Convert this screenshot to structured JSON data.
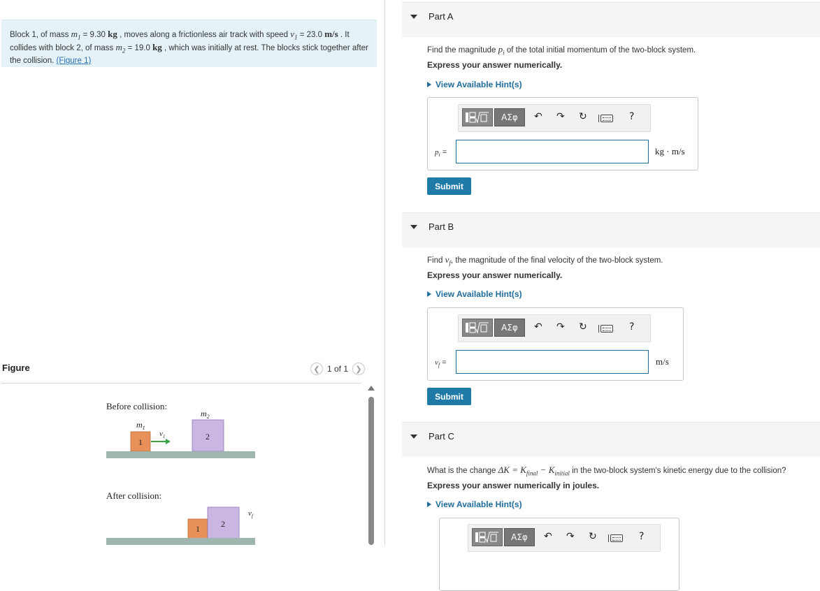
{
  "problem": {
    "t1": "Block 1, of mass ",
    "m1_sym": "m",
    "m1_sub": "1",
    "t2": " = 9.30 ",
    "kg1": "kg",
    "t3": " , moves along a frictionless air track with speed ",
    "v1_sym": "v",
    "v1_sub": "1",
    "t4": " = 23.0 ",
    "mps": "m/s",
    "t5": " . It collides with block 2, of mass ",
    "m2_sym": "m",
    "m2_sub": "2",
    "t6": " = 19.0 ",
    "kg2": "kg",
    "t7": " , which was initially at rest. The blocks stick together after the collision. ",
    "figure_link": "(Figure 1)"
  },
  "figure_panel": {
    "label": "Figure",
    "page": "1 of 1",
    "prev_icon": "chevron-left-icon",
    "next_icon": "chevron-right-icon",
    "before_label": "Before collision:",
    "after_label": "After collision:",
    "m1_label": "m",
    "m1_sub": "1",
    "m2_label": "m",
    "m2_sub": "2",
    "v1_label": "v",
    "v1_sub": "1",
    "vf_label": "v",
    "vf_sub": "f",
    "block1": "1",
    "block2": "2",
    "colors": {
      "block1": "#e8915a",
      "block2": "#c9b6e3",
      "arrow": "#3aa040",
      "track": "#9fb5b0"
    }
  },
  "toolbar": {
    "greek": "ΑΣφ",
    "undo_icon": "undo-icon",
    "redo_icon": "redo-icon",
    "reset_icon": "reset-icon",
    "keyboard_icon": "keyboard-icon",
    "help": "?"
  },
  "parts": [
    {
      "title": "Part A",
      "q_pre": "Find the magnitude ",
      "q_sym": "p",
      "q_sub": "i",
      "q_post": " of the total initial momentum of the two-block system.",
      "express": "Express your answer numerically.",
      "hint": "View Available Hint(s)",
      "var_sym": "p",
      "var_sub": "i",
      "eq": " =",
      "unit": "kg · m/s",
      "input_value": "",
      "submit": "Submit"
    },
    {
      "title": "Part B",
      "q_pre": "Find ",
      "q_sym": "v",
      "q_sub": "f",
      "q_post": ", the magnitude of the final velocity of the two-block system.",
      "express": "Express your answer numerically.",
      "hint": "View Available Hint(s)",
      "var_sym": "v",
      "var_sub": "f",
      "eq": " =",
      "unit": "m/s",
      "input_value": "",
      "submit": "Submit"
    },
    {
      "title": "Part C",
      "q_pre": "What is the change ",
      "q_eq1": "ΔK = K",
      "q_sub1": "final",
      "q_eq2": " − K",
      "q_sub2": "initial",
      "q_post": " in the two-block system's kinetic energy due to the collision?",
      "express": "Express your answer numerically in joules.",
      "hint": "View Available Hint(s)"
    }
  ]
}
